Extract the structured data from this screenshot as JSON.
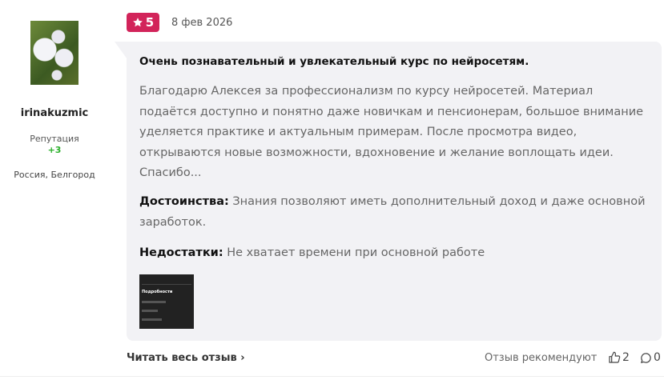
{
  "user": {
    "name": "irinakuzmic",
    "reputation_label": "Репутация",
    "reputation_value": "+3",
    "location": "Россия, Белгород"
  },
  "review": {
    "rating": "5",
    "date": "8 фев 2026",
    "title": "Очень познавательный и увлекательный курс по нейросетям.",
    "text": "Благодарю Алексея за профессионализм по курсу нейросетей. Материал подаётся доступно и понятно даже новичкам и пенсионерам, большое внимание уделяется практике и актуальным примерам. После просмотра видео, открываются новые возможности, вдохновение и желание воплощать идеи. Спасибо...",
    "pros_label": "Достоинства:",
    "pros": "Знания позволяют иметь дополнительный доход и даже основной заработок.",
    "cons_label": "Недостатки:",
    "cons": "Не хватает времени при основной работе",
    "thumb_heading": "Подробности"
  },
  "footer": {
    "read_all": "Читать весь отзыв",
    "recommend_label": "Отзыв рекомендуют",
    "likes": "2",
    "comments": "0"
  },
  "colors": {
    "badge": "#d2245a",
    "reputation": "#2bb02b",
    "card": "#f2f2f5"
  }
}
